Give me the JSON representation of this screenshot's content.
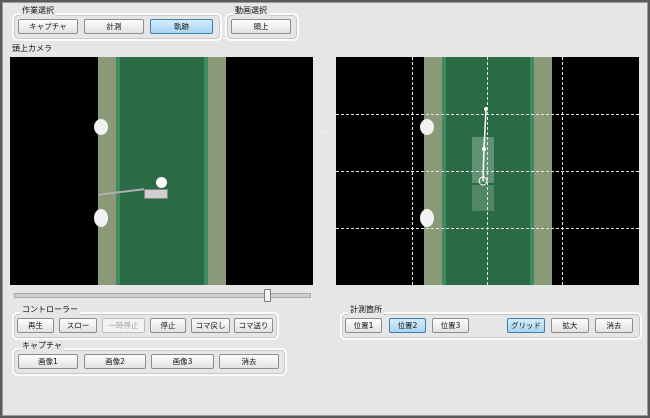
{
  "work_select": {
    "label": "作業選択",
    "buttons": [
      "キャプチャ",
      "計測",
      "軌跡"
    ],
    "active": "軌跡"
  },
  "video_select": {
    "label": "動画選択",
    "buttons": [
      "頭上"
    ]
  },
  "camera_label": "頭上カメラ",
  "separator": "—",
  "playback_slider": {
    "position_fraction": 0.86
  },
  "controller": {
    "label": "コントローラー",
    "buttons": [
      "再生",
      "スロー",
      "一時停止",
      "停止",
      "コマ戻し",
      "コマ送り"
    ],
    "disabled": "一時停止"
  },
  "capture": {
    "label": "キャプチャ",
    "buttons": [
      "画像1",
      "画像2",
      "画像3",
      "消去"
    ]
  },
  "measure_point": {
    "label": "計測箇所",
    "buttons": [
      "位置1",
      "位置2",
      "位置3",
      "グリッド",
      "拡大",
      "消去"
    ],
    "active": [
      "位置2",
      "グリッド"
    ]
  },
  "colors": {
    "window_bg": "#e6e6e6",
    "active_button": "#a8d4f1",
    "putting_mat": "#2a6a45",
    "trajectory": "#ffffff"
  }
}
